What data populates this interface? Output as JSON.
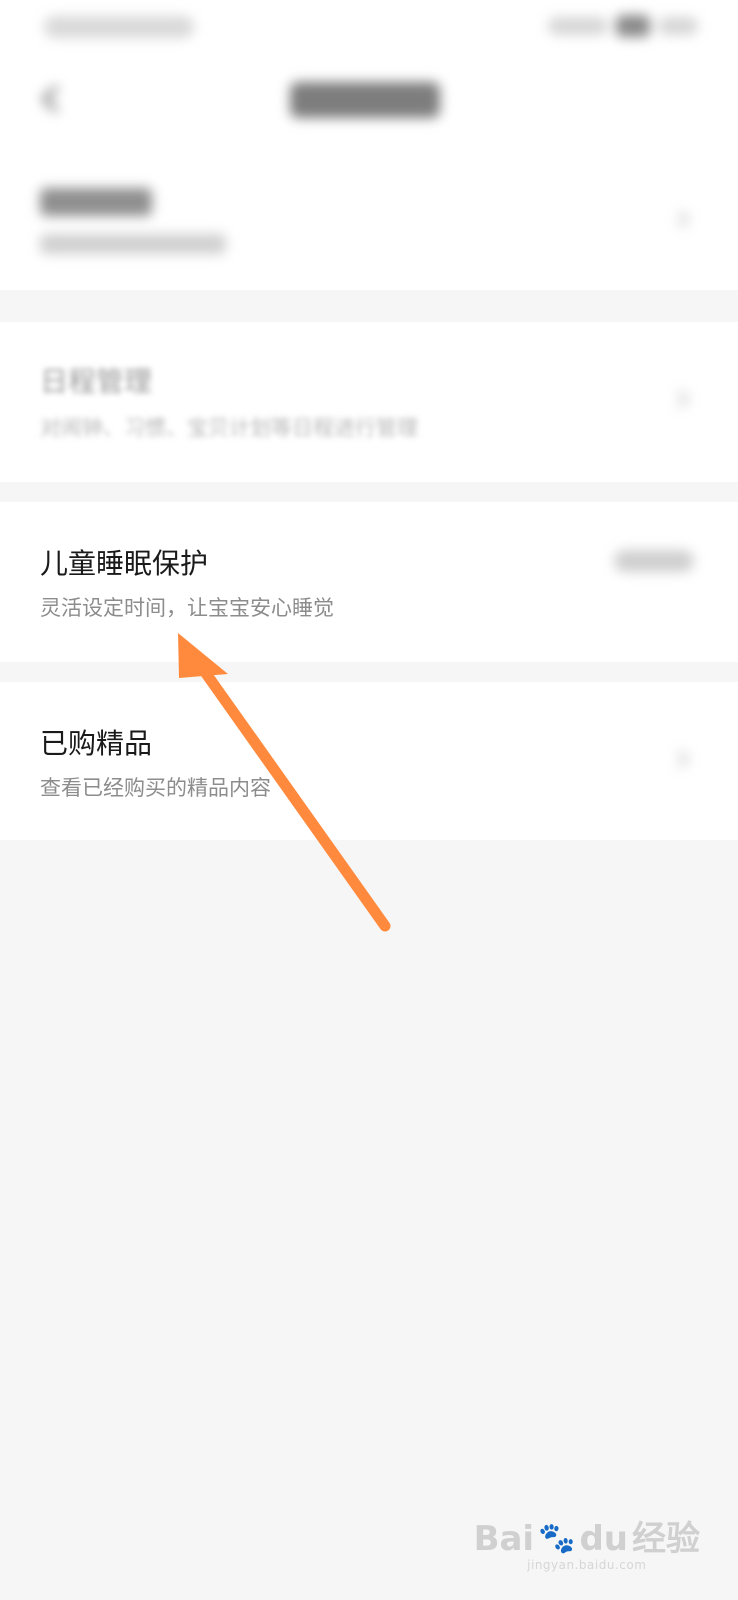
{
  "settings_list": {
    "items": [
      {
        "title": "日程管理",
        "subtitle": "对闹钟、习惯、宝贝计划等日程进行管理"
      },
      {
        "title": "儿童睡眠保护",
        "subtitle": "灵活设定时间，让宝宝安心睡觉"
      },
      {
        "title": "已购精品",
        "subtitle": "查看已经购买的精品内容"
      }
    ]
  },
  "annotation": {
    "color": "#ff8a3d"
  },
  "watermark": {
    "logo_text": "Bai",
    "logo_text_2": "du",
    "logo_cn": "经验",
    "url": "jingyan.baidu.com"
  }
}
